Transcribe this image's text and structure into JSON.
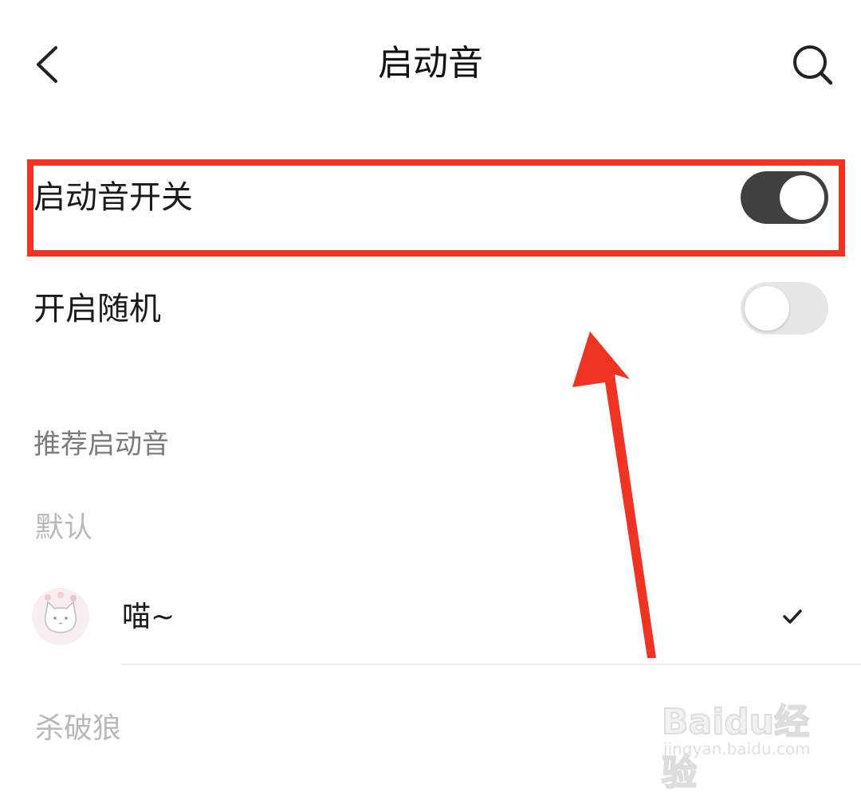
{
  "header": {
    "title": "启动音",
    "back_icon": "chevron-left-icon",
    "search_icon": "search-icon"
  },
  "settings": {
    "startup_sound_switch": {
      "label": "启动音开关",
      "enabled": true
    },
    "random_switch": {
      "label": "开启随机",
      "enabled": false
    }
  },
  "recommended": {
    "section_title": "推荐启动音",
    "categories": [
      {
        "name": "默认",
        "items": [
          {
            "name": "喵~",
            "selected": true
          }
        ]
      },
      {
        "name": "杀破狼"
      }
    ]
  },
  "annotation": {
    "highlight_color": "#ee3322",
    "arrow_color": "#ee3322"
  },
  "colors": {
    "toggle_on": "#404040",
    "toggle_off": "#e6e6e6"
  },
  "watermark": {
    "logo": "Baidu经验",
    "url": "jingyan.baidu.com"
  }
}
